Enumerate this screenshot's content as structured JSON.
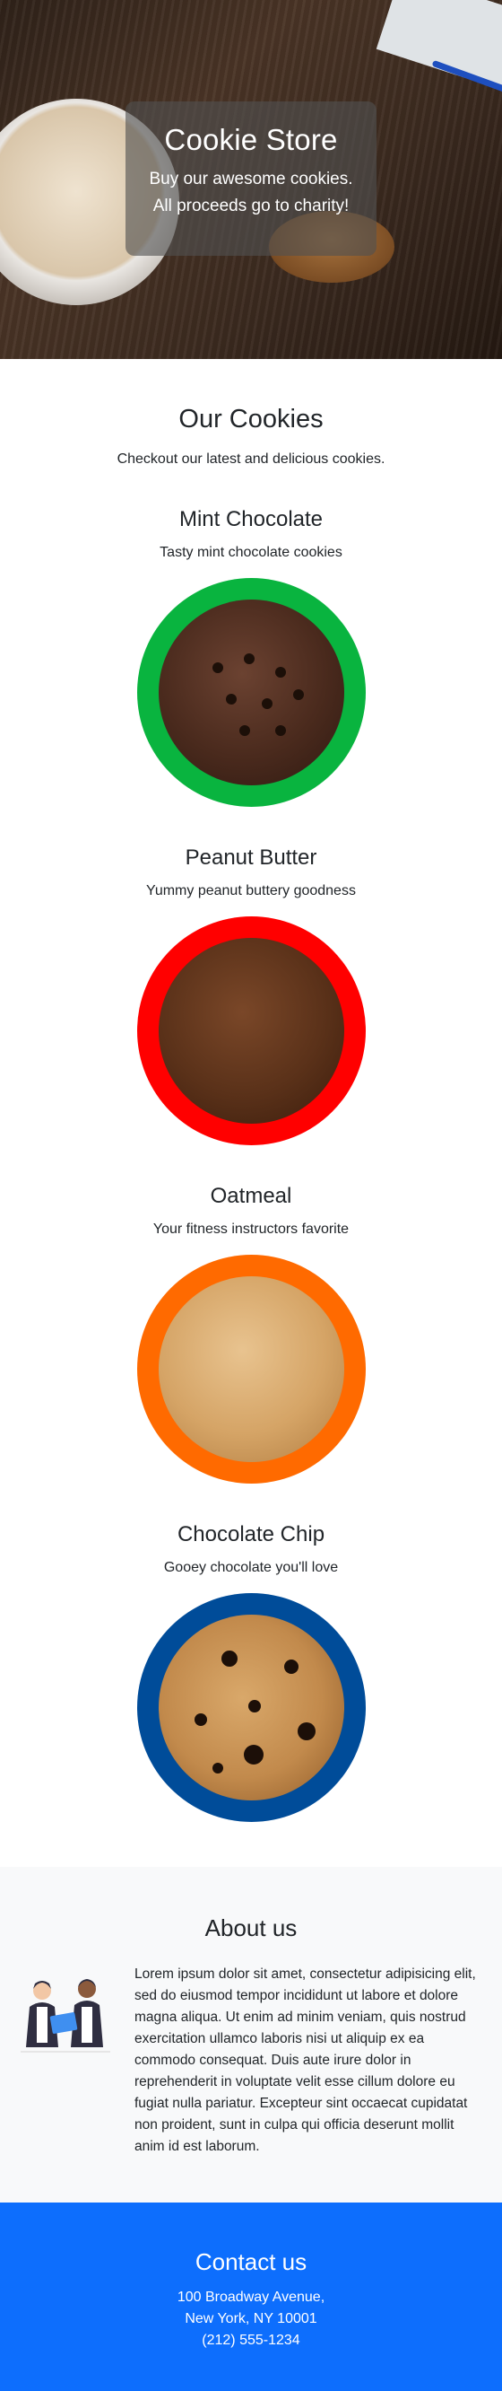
{
  "hero": {
    "title": "Cookie Store",
    "subtitle_line1": "Buy our awesome cookies.",
    "subtitle_line2": "All proceeds go to charity!"
  },
  "cookies_section": {
    "title": "Our Cookies",
    "subtitle": "Checkout our latest and delicious cookies."
  },
  "cookies": [
    {
      "name": "Mint Chocolate",
      "description": "Tasty mint chocolate cookies",
      "ring_color": "#09b43f"
    },
    {
      "name": "Peanut Butter",
      "description": "Yummy peanut buttery goodness",
      "ring_color": "#ff0000"
    },
    {
      "name": "Oatmeal",
      "description": "Your fitness instructors favorite",
      "ring_color": "#ff6a00"
    },
    {
      "name": "Chocolate Chip",
      "description": "Gooey chocolate you'll love",
      "ring_color": "#004c99"
    }
  ],
  "about": {
    "title": "About us",
    "text": "Lorem ipsum dolor sit amet, consectetur adipisicing elit, sed do eiusmod tempor incididunt ut labore et dolore magna aliqua. Ut enim ad minim veniam, quis nostrud exercitation ullamco laboris nisi ut aliquip ex ea commodo consequat. Duis aute irure dolor in reprehenderit in voluptate velit esse cillum dolore eu fugiat nulla pariatur. Excepteur sint occaecat cupidatat non proident, sunt in culpa qui officia deserunt mollit anim id est laborum."
  },
  "contact": {
    "title": "Contact us",
    "address_line1": "100 Broadway Avenue,",
    "address_line2": "New York, NY 10001",
    "phone": "(212) 555-1234"
  },
  "colors": {
    "contact_bg": "#0d6efd",
    "about_bg": "#f8f9fa"
  }
}
